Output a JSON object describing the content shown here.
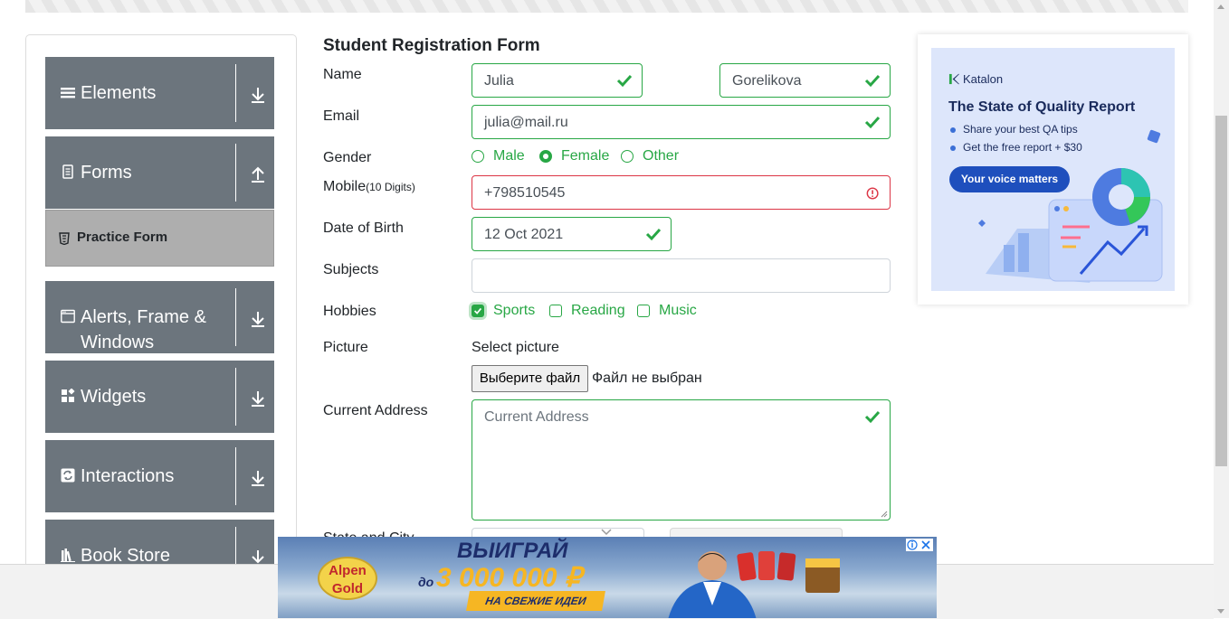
{
  "sidebar": {
    "groups": [
      {
        "label": "Elements",
        "icon": "list-icon",
        "arrow": "down"
      },
      {
        "label": "Forms",
        "icon": "document-icon",
        "arrow": "up"
      },
      {
        "label": "Alerts, Frame & Windows",
        "icon": "window-icon",
        "arrow": "down"
      },
      {
        "label": "Widgets",
        "icon": "widgets-icon",
        "arrow": "down"
      },
      {
        "label": "Interactions",
        "icon": "refresh-icon",
        "arrow": "down"
      },
      {
        "label": "Book Store",
        "icon": "books-icon",
        "arrow": "down"
      }
    ],
    "active_item": {
      "label": "Practice Form",
      "icon": "html5-icon"
    }
  },
  "form": {
    "title": "Student Registration Form",
    "name_label": "Name",
    "first_name": "Julia",
    "last_name": "Gorelikova",
    "email_label": "Email",
    "email": "julia@mail.ru",
    "gender_label": "Gender",
    "gender_options": [
      "Male",
      "Female",
      "Other"
    ],
    "gender_selected": "Female",
    "mobile_label": "Mobile",
    "mobile_hint": "(10 Digits)",
    "mobile": "+798510545",
    "dob_label": "Date of Birth",
    "dob": "12 Oct 2021",
    "subjects_label": "Subjects",
    "subjects_value": "",
    "hobbies_label": "Hobbies",
    "hobbies": [
      {
        "label": "Sports",
        "checked": true
      },
      {
        "label": "Reading",
        "checked": false
      },
      {
        "label": "Music",
        "checked": false
      }
    ],
    "picture_label": "Picture",
    "select_picture": "Select picture",
    "file_button": "Выберите файл",
    "file_status": "Файл не выбран",
    "address_label": "Current Address",
    "address_placeholder": "Current Address",
    "state_city_label": "State and City"
  },
  "ad_right": {
    "brand": "Katalon",
    "title": "The State of Quality Report",
    "bullets": [
      "Share your best QA tips",
      "Get the free report + $30"
    ],
    "cta": "Your voice matters"
  },
  "ad_bottom": {
    "logo_top": "Alpen",
    "logo_bottom": "Gold",
    "headline": "ВЫИГРАЙ",
    "prefix": "до",
    "amount": "3 000 000 ₽",
    "subline": "НА СВЕЖИЕ ИДЕИ"
  },
  "colors": {
    "valid": "#28a745",
    "invalid": "#dc3545",
    "sidebar": "#6c757d",
    "active": "#aeaeae"
  }
}
